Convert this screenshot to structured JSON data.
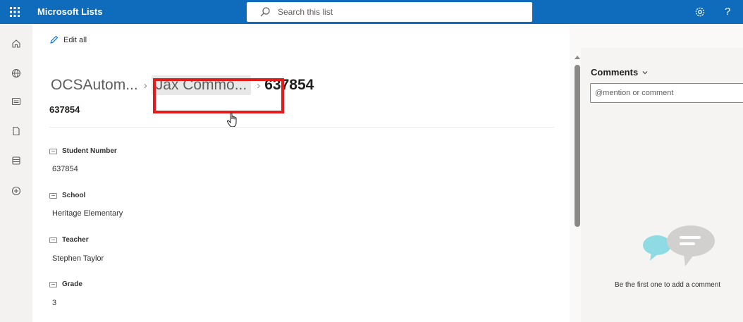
{
  "topbar": {
    "app_title": "Microsoft Lists",
    "search_placeholder": "Search this list",
    "help_label": "?"
  },
  "rail": {
    "icons": [
      "home-icon",
      "globe-icon",
      "lists-icon",
      "document-icon",
      "layers-icon",
      "add-icon"
    ]
  },
  "toolbar": {
    "edit_all_label": "Edit all"
  },
  "breadcrumb": {
    "item1": "OCSAutom...",
    "item2": "Jax Commo...",
    "item3": "637854"
  },
  "item": {
    "title": "637854",
    "fields": [
      {
        "label": "Student Number",
        "value": "637854"
      },
      {
        "label": "School",
        "value": "Heritage Elementary"
      },
      {
        "label": "Teacher",
        "value": "Stephen Taylor"
      },
      {
        "label": "Grade",
        "value": "3"
      }
    ]
  },
  "comments": {
    "header": "Comments",
    "placeholder": "@mention or comment",
    "empty_text": "Be the first one to add a comment"
  },
  "colors": {
    "brand": "#0f6cbd",
    "highlight_box": "#e31b1b",
    "illustration_teal": "#8fdbe3",
    "illustration_gray": "#d2d0ce"
  }
}
